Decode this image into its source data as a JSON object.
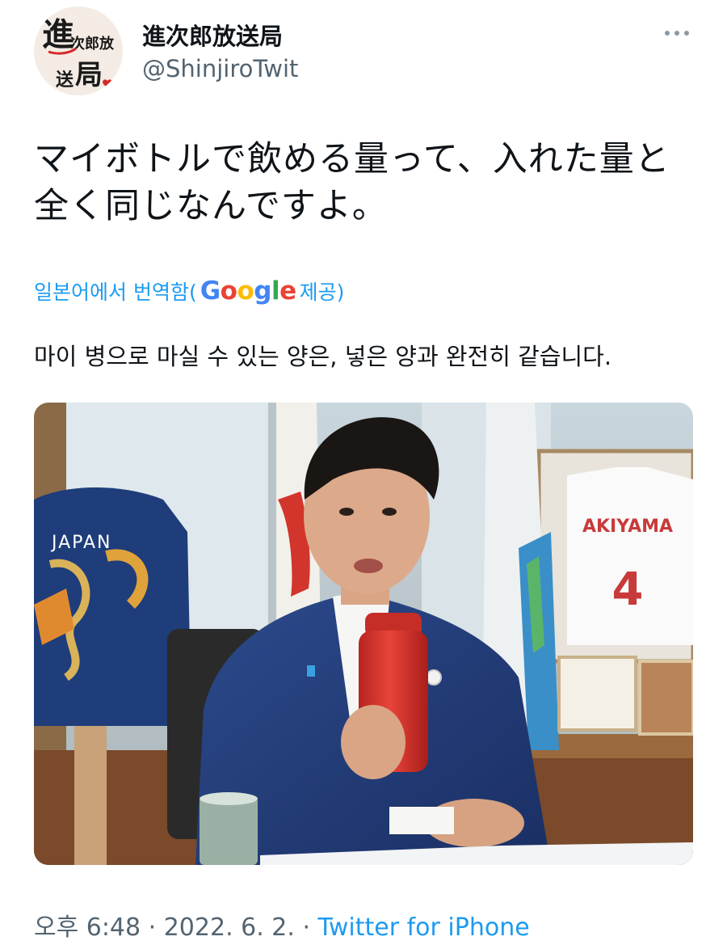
{
  "tweet": {
    "author": {
      "display_name": "進次郎放送局",
      "handle": "@ShinjiroTwit",
      "avatar_text": [
        "進",
        "次郎放",
        "送",
        "局"
      ]
    },
    "text_lines": [
      "マイボトルで飲める量って、入れた量と",
      "全く同じなんですよ。"
    ],
    "translation": {
      "prefix": "일본어에서 번역함(",
      "provider": "Google",
      "suffix": " 제공)",
      "text": "마이 병으로 마실 수 있는 양은, 넣은 양과 완전히 같습니다."
    },
    "photo": {
      "jacket_text": "JAPAN",
      "jersey_name": "AKIYAMA",
      "jersey_number": "4"
    },
    "timestamp": {
      "time": "오후 6:48",
      "separator": " · ",
      "date": "2022. 6. 2.",
      "source": "Twitter for iPhone"
    }
  },
  "colors": {
    "link_blue": "#1d9bf0",
    "secondary_gray": "#536471",
    "text": "#0f1419"
  },
  "icons": {
    "more": "more-horizontal-icon"
  }
}
